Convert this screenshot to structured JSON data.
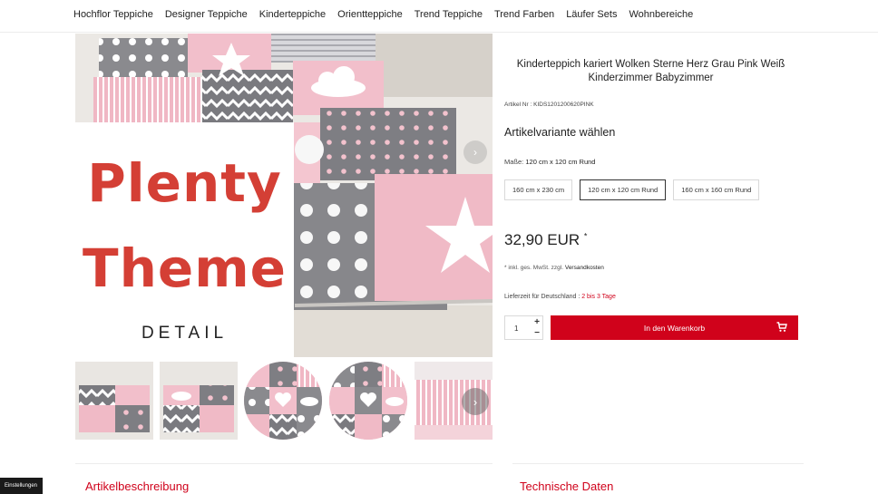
{
  "nav": {
    "items": [
      "Hochflor Teppiche",
      "Designer Teppiche",
      "Kinderteppiche",
      "Orientteppiche",
      "Trend Teppiche",
      "Trend Farben",
      "Läufer Sets",
      "Wohnbereiche"
    ]
  },
  "promo": {
    "line1": "Plenty",
    "line2": "Theme",
    "line3": "DETAIL"
  },
  "gallery": {
    "image_arrow": "›",
    "thumb_arrow": "›",
    "thumb_count": 5
  },
  "product": {
    "title": "Kinderteppich kariert Wolken Sterne Herz Grau Pink Weiß Kinderzimmer Babyzimmer",
    "article_number": "Artikel Nr : KIDS1201200620PINK",
    "variant_heading": "Artikelvariante wählen",
    "size_label": "Maße:",
    "size_value": "120 cm x 120 cm Rund",
    "sizes": [
      "160 cm x 230 cm",
      "120 cm x 120 cm Rund",
      "160 cm x 160 cm Rund"
    ],
    "selected_size_index": 1,
    "price": "32,90 EUR",
    "price_mark": "*",
    "vat_prefix": "* inkl. ges. MwSt. zzgl.",
    "vat_link": "Versandkosten",
    "delivery_prefix": "Lieferzeit für Deutschland :",
    "delivery_time": "2 bis 3 Tage",
    "quantity": "1",
    "qty_plus": "+",
    "qty_minus": "−",
    "cart_button": "In den Warenkorb"
  },
  "sections": {
    "description": "Artikelbeschreibung",
    "technical": "Technische Daten"
  },
  "cookie": {
    "label": "Einstellungen"
  },
  "colors": {
    "accent_red": "#d0021b",
    "promo_red": "#d43f35",
    "rug_pink": "#f2bfcb",
    "rug_grey": "#8a8a8e"
  },
  "icons": [
    "chevron-right-icon",
    "cart-icon",
    "plus-icon",
    "minus-icon",
    "star-icon",
    "cloud-icon",
    "heart-icon"
  ]
}
